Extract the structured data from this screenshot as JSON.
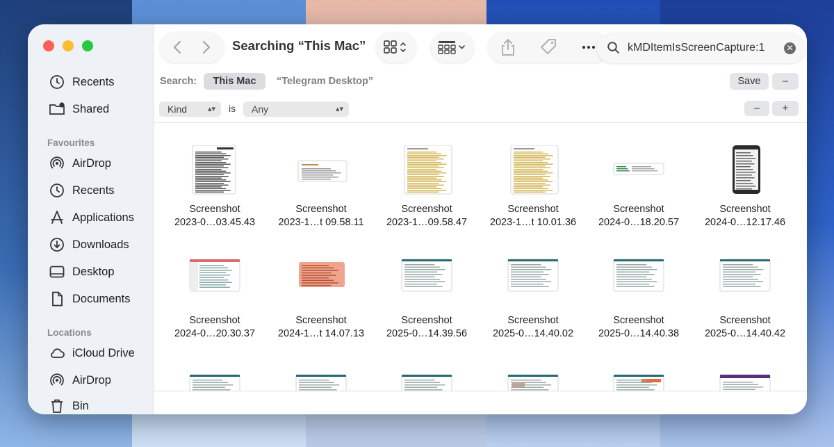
{
  "window": {
    "title": "Searching “This Mac”",
    "search_query": "kMDItemIsScreenCapture:1"
  },
  "sidebar": {
    "top_items": [
      {
        "label": "Recents",
        "icon": "clock-icon"
      },
      {
        "label": "Shared",
        "icon": "shared-folder-icon"
      }
    ],
    "favourites_heading": "Favourites",
    "favourites": [
      {
        "label": "AirDrop",
        "icon": "airdrop-icon"
      },
      {
        "label": "Recents",
        "icon": "clock-icon"
      },
      {
        "label": "Applications",
        "icon": "applications-icon"
      },
      {
        "label": "Downloads",
        "icon": "download-icon"
      },
      {
        "label": "Desktop",
        "icon": "desktop-icon"
      },
      {
        "label": "Documents",
        "icon": "document-icon"
      }
    ],
    "locations_heading": "Locations",
    "locations": [
      {
        "label": "iCloud Drive",
        "icon": "cloud-icon"
      },
      {
        "label": "AirDrop",
        "icon": "airdrop-icon"
      },
      {
        "label": "Bin",
        "icon": "trash-icon"
      }
    ]
  },
  "scope": {
    "label": "Search:",
    "selected": "This Mac",
    "alternative": "“Telegram Desktop”",
    "save_label": "Save",
    "remove_label": "–"
  },
  "criteria": {
    "attribute": "Kind",
    "operator": "is",
    "value": "Any",
    "remove_label": "–",
    "add_label": "+"
  },
  "files": [
    {
      "line1": "Screenshot",
      "line2": "2023-0…03.45.43",
      "thumb": "doc"
    },
    {
      "line1": "Screenshot",
      "line2": "2023-1…t 09.58.11",
      "thumb": "wide"
    },
    {
      "line1": "Screenshot",
      "line2": "2023-1…09.58.47",
      "thumb": "doc-yellow"
    },
    {
      "line1": "Screenshot",
      "line2": "2023-1…t 10.01.36",
      "thumb": "doc-yellow"
    },
    {
      "line1": "Screenshot",
      "line2": "2024-0…18.20.57",
      "thumb": "strip"
    },
    {
      "line1": "Screenshot",
      "line2": "2024-0…12.17.46",
      "thumb": "phone"
    },
    {
      "line1": "Screenshot",
      "line2": "2024-0…20.30.37",
      "thumb": "app-red"
    },
    {
      "line1": "Screenshot",
      "line2": "2024-1…t 14.07.13",
      "thumb": "orange"
    },
    {
      "line1": "Screenshot",
      "line2": "2025-0…14.39.56",
      "thumb": "table"
    },
    {
      "line1": "Screenshot",
      "line2": "2025-0…14.40.02",
      "thumb": "table"
    },
    {
      "line1": "Screenshot",
      "line2": "2025-0…14.40.38",
      "thumb": "table"
    },
    {
      "line1": "Screenshot",
      "line2": "2025-0…14.40.42",
      "thumb": "table"
    }
  ],
  "partial_row_thumbs": [
    "table",
    "table",
    "table",
    "table-red",
    "table-orange",
    "purple"
  ]
}
